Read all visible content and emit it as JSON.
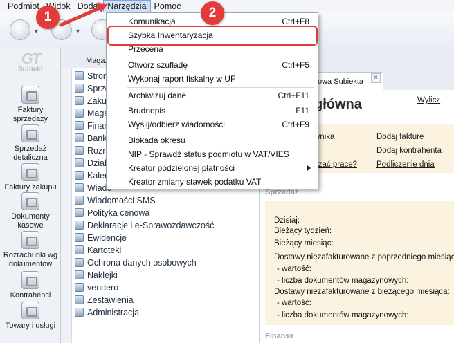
{
  "menubar": {
    "items": [
      "Podmiot",
      "Widok",
      "Dodaj",
      "Narzędzia",
      "Pomoc"
    ],
    "active": "Narzędzia"
  },
  "sidebar": {
    "logo": "Subiekt",
    "items": [
      {
        "label": "Faktury sprzedaży",
        "icon": "invoice-stack-icon"
      },
      {
        "label": "Sprzedaż detaliczna",
        "icon": "receipt-icon"
      },
      {
        "label": "Faktury zakupu",
        "icon": "purchase-invoice-icon"
      },
      {
        "label": "Dokumenty kasowe",
        "icon": "cash-register-icon"
      },
      {
        "label": "Rozrachunki wg dokumentów",
        "icon": "settlements-icon"
      },
      {
        "label": "Kontrahenci",
        "icon": "contact-person-icon"
      },
      {
        "label": "Towary i usługi",
        "icon": "products-icon"
      }
    ]
  },
  "behind": {
    "magazyn_link": "Magaz"
  },
  "tree": {
    "items": [
      "Strony",
      "Sprze",
      "Zakup",
      "Magaz",
      "Finan",
      "Bank",
      "Rozra",
      "Działa",
      "Kalen",
      "Wiado",
      "Wiadomości SMS",
      "Polityka cenowa",
      "Deklaracje i e-Sprawozdawczość",
      "Ewidencje",
      "Kartoteki",
      "Ochrona danych osobowych",
      "Naklejki",
      "vendero",
      "Zestawienia",
      "Administracja"
    ]
  },
  "tab": {
    "label": "owa Subiekta",
    "close": "×"
  },
  "main": {
    "title": "główna",
    "wylicz": "Wylicz",
    "links_left": [
      "wnika",
      "e",
      "czać prace?"
    ],
    "links_right": [
      "Dodaj fakture",
      "Dodaj kontrahenta",
      "Podliczenie dnia"
    ],
    "section_sales": "Sprzedaż",
    "sales_lines": [
      "Dzisiaj:",
      "Bieżący tydzień:",
      "Bieżący miesiąc:",
      "Dostawy niezafakturowane z poprzedniego miesiąca:",
      "- wartość:",
      "- liczba dokumentów magazynowych:",
      "Dostawy niezafakturowane z bieżącego miesiąca:",
      "- wartość:",
      "- liczba dokumentów magazynowych:"
    ],
    "section_finance": "Finanse"
  },
  "dropdown": {
    "items": [
      {
        "label": "Komunikacja",
        "shortcut": "Ctrl+F8"
      },
      {
        "label": "Szybka Inwentaryzacja",
        "shortcut": ""
      },
      {
        "label": "Przecena",
        "shortcut": ""
      },
      {
        "label": "Otwórz szufladę",
        "shortcut": "Ctrl+F5"
      },
      {
        "label": "Wykonaj raport fiskalny w UF",
        "shortcut": ""
      },
      {
        "label": "Archiwizuj dane",
        "shortcut": "Ctrl+F11"
      },
      {
        "label": "Brudnopis",
        "shortcut": "F11"
      },
      {
        "label": "Wyślij/odbierz wiadomości",
        "shortcut": "Ctrl+F9"
      },
      {
        "label": "Blokada okresu",
        "shortcut": ""
      },
      {
        "label": "NIP - Sprawdź status podmiotu w VAT/VIES",
        "shortcut": ""
      },
      {
        "label": "Kreator podzielonej płatności",
        "shortcut": ""
      },
      {
        "label": "Kreator zmiany stawek podatku VAT",
        "shortcut": ""
      }
    ]
  },
  "annotations": {
    "step1": "1",
    "step2": "2",
    "color": "#e23b3b"
  }
}
